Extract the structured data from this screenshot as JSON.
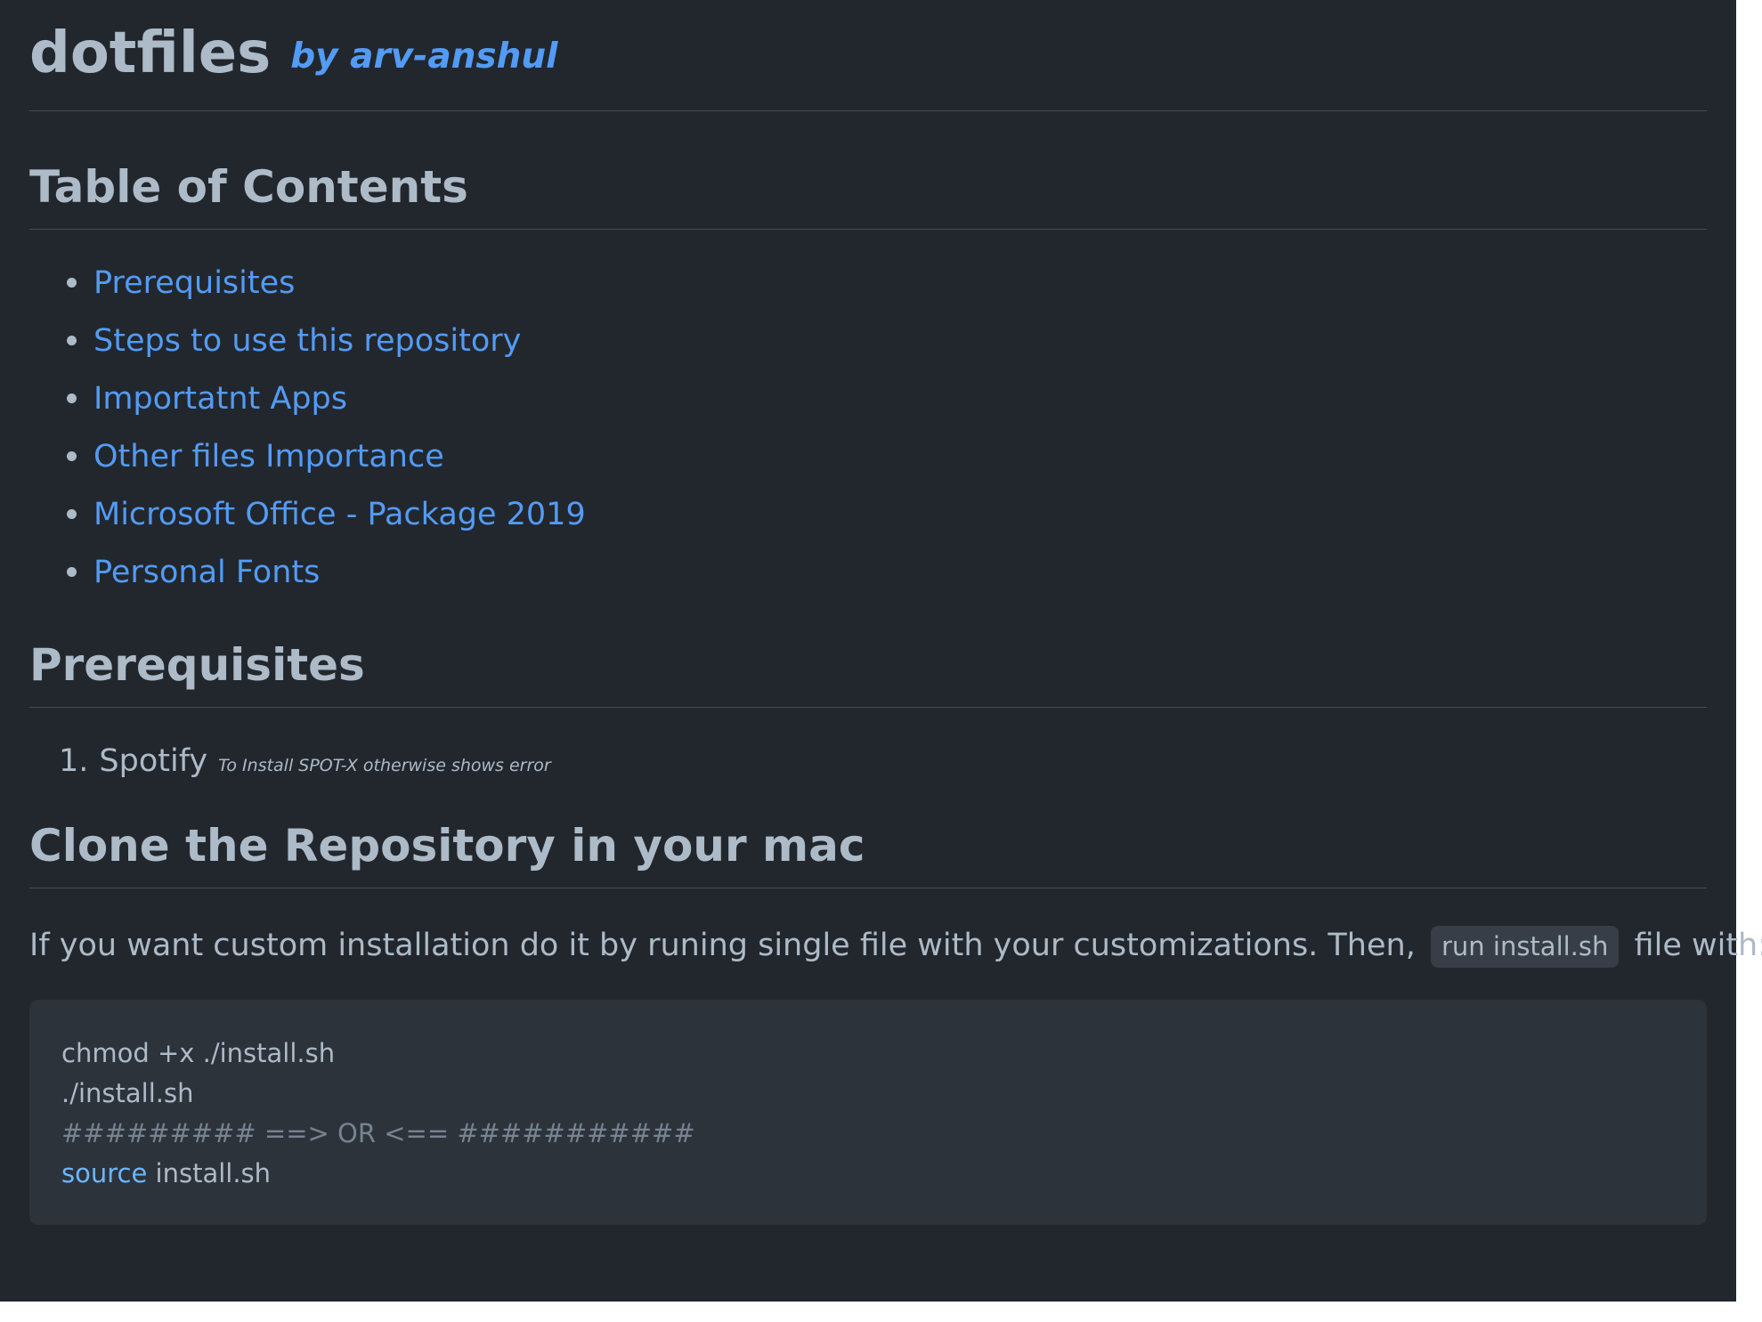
{
  "header": {
    "title": "dotfiles",
    "author": "by arv-anshul"
  },
  "toc": {
    "heading": "Table of Contents",
    "items": [
      {
        "label": "Prerequisites"
      },
      {
        "label": "Steps to use this repository"
      },
      {
        "label": "Importatnt Apps"
      },
      {
        "label": "Other files Importance"
      },
      {
        "label": "Microsoft Office - Package 2019"
      },
      {
        "label": "Personal Fonts"
      }
    ]
  },
  "prerequisites": {
    "heading": "Prerequisites",
    "items": [
      {
        "number": "1.",
        "name": "Spotify",
        "note": "To Install SPOT-X otherwise shows error"
      }
    ]
  },
  "clone": {
    "heading": "Clone the Repository in your mac",
    "text_before": "If you want custom installation do it by runing single file with your customizations. Then,",
    "inline_code": "run install.sh",
    "text_after": "file with:",
    "code": {
      "line1": "chmod +x ./install.sh",
      "line2": "./install.sh",
      "line3": "######### ==> OR <== ###########",
      "line4_keyword": "source",
      "line4_rest": " install.sh"
    }
  },
  "colors": {
    "background": "#22272e",
    "text": "#adbac7",
    "link": "#539bf5",
    "code_bg": "#2d333b"
  }
}
